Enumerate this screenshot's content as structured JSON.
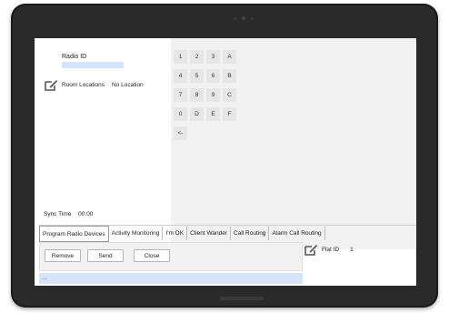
{
  "radio": {
    "label": "Radio ID",
    "value": ""
  },
  "room": {
    "label": "Room Locations",
    "value": "No Location",
    "icon": "edit-icon"
  },
  "keypad": {
    "keys": [
      "1",
      "2",
      "3",
      "A",
      "4",
      "5",
      "6",
      "B",
      "7",
      "8",
      "9",
      "C",
      "0",
      "D",
      "E",
      "F",
      "<-"
    ]
  },
  "sync": {
    "label": "Sync Time",
    "value": "00:00"
  },
  "tabs": [
    {
      "label": "Program Radio Devices",
      "active": true
    },
    {
      "label": "Activity Monitoring",
      "active": false
    },
    {
      "label": "I'm OK",
      "active": false
    },
    {
      "label": "Client Wander",
      "active": false
    },
    {
      "label": "Call Routing",
      "active": false
    },
    {
      "label": "Alarm Call Routing",
      "active": false
    }
  ],
  "actions": {
    "remove": "Remove",
    "send": "Send",
    "close": "Close"
  },
  "flat": {
    "label": "Flat ID",
    "value": "1",
    "icon": "edit-icon"
  },
  "status": {
    "text": "..."
  },
  "colors": {
    "input_highlight": "#d6e4fb",
    "panel_bg": "#f1f1f1",
    "bezel": "#1a1a1a"
  }
}
